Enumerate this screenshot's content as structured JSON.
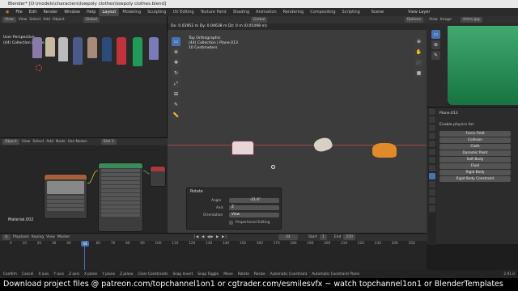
{
  "window": {
    "title": "Blender* [D:\\models\\characters\\lowpoly clothes\\lowpoly clothes.blend]"
  },
  "menubar": {
    "menus": [
      "File",
      "Edit",
      "Render",
      "Window",
      "Help"
    ],
    "workspaces": [
      "Layout",
      "Modeling",
      "Sculpting",
      "UV Editing",
      "Texture Paint",
      "Shading",
      "Animation",
      "Rendering",
      "Compositing",
      "Scripting"
    ],
    "active_workspace": "Layout",
    "scene_label": "Scene",
    "view_layer_label": "View Layer"
  },
  "image_editor": {
    "mode": "View",
    "menus": [
      "View",
      "Select",
      "Add",
      "Object"
    ],
    "overlay_title": "User Perspective",
    "overlay_collection": "(44) Collection | Plane.013"
  },
  "node_editor": {
    "object_label": "Object",
    "menus": [
      "View",
      "Select",
      "Add",
      "Node"
    ],
    "use_nodes": "Use Nodes",
    "slot": "Slot 1",
    "material": "Material.002"
  },
  "viewport": {
    "global_label": "Global",
    "options_label": "Options",
    "delta_readout": "Dx: 0.02952 m  Dy: 0.04638 m  Dz: 0 m (0.05498 m)",
    "view_name": "Top Orthographic",
    "collection": "(44) Collection | Plane.013",
    "scale_note": "10 Centimeters",
    "rotate_panel": {
      "title": "Rotate",
      "angle_label": "Angle",
      "angle_value": "-21.6°",
      "axis_label": "Axis",
      "axis_value": "Z",
      "orientation_label": "Orientation",
      "orientation_value": "View",
      "proportional_label": "Proportional Editing"
    }
  },
  "right_image": {
    "filename": "shirts.jpg",
    "menus": [
      "View",
      "Image"
    ]
  },
  "properties": {
    "object_name": "Plane.013",
    "section_label": "Enable physics for:",
    "physics_buttons": [
      "Force Field",
      "Collision",
      "Cloth",
      "Dynamic Paint",
      "Soft Body",
      "Fluid",
      "Rigid Body",
      "Rigid Body Constraint"
    ]
  },
  "timeline": {
    "menus": [
      "Playback",
      "Keying",
      "View",
      "Marker"
    ],
    "current_frame": "44",
    "start_label": "Start",
    "start_value": "1",
    "end_label": "End",
    "end_value": "250",
    "ticks": [
      "0",
      "10",
      "20",
      "30",
      "40",
      "50",
      "60",
      "70",
      "80",
      "90",
      "100",
      "110",
      "120",
      "130",
      "140",
      "150",
      "160",
      "170",
      "180",
      "190",
      "200",
      "210",
      "220",
      "230",
      "240",
      "250"
    ]
  },
  "statusbar": {
    "items": [
      "Confirm",
      "Cancel",
      "X axis",
      "Y axis",
      "Z axis",
      "X plane",
      "Y plane",
      "Z plane",
      "Clear Constraints",
      "Snap Invert",
      "Snap Toggle",
      "Move",
      "Rotate",
      "Resize",
      "Automatic Constraint",
      "Automatic Constraint Plane"
    ],
    "version": "2.91.0"
  },
  "banner": {
    "text": "Download project files @ patreon.com/topchannel1on1 or cgtrader.com/esmilesvfx ~ watch topchannel1on1 or BlenderTemplates"
  },
  "colors": {
    "accent": "#4772b3",
    "orange_garment": "#e08a2a",
    "green_garment": "#1f9a57",
    "red_garment": "#c0333b"
  }
}
